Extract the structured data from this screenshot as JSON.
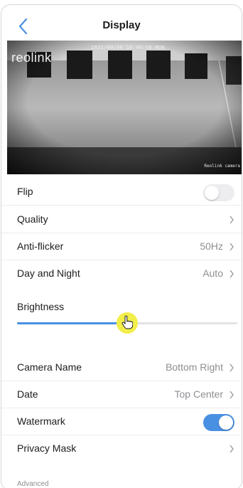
{
  "header": {
    "title": "Display"
  },
  "preview": {
    "logo": "reolink",
    "timestamp": "2021/09/06 16:46:58 MON",
    "camera_label": "Reolink camera"
  },
  "settings": {
    "flip": {
      "label": "Flip",
      "enabled": false
    },
    "quality": {
      "label": "Quality"
    },
    "anti_flicker": {
      "label": "Anti-flicker",
      "value": "50Hz"
    },
    "day_night": {
      "label": "Day and Night",
      "value": "Auto"
    },
    "brightness": {
      "label": "Brightness",
      "level": 0.5
    },
    "camera_name": {
      "label": "Camera Name",
      "value": "Bottom Right"
    },
    "date": {
      "label": "Date",
      "value": "Top Center"
    },
    "watermark": {
      "label": "Watermark",
      "enabled": true
    },
    "privacy_mask": {
      "label": "Privacy Mask"
    }
  },
  "footer": {
    "advanced_label": "Advanced"
  },
  "colors": {
    "accent": "#4a90e2",
    "cursor_highlight": "#f2ee4a"
  }
}
